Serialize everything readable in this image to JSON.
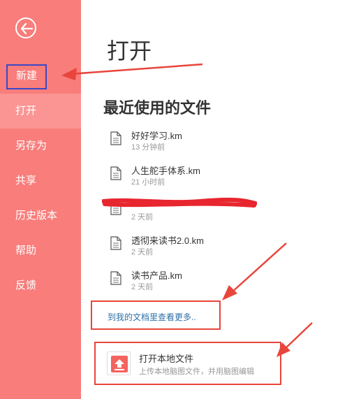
{
  "sidebar": {
    "items": [
      {
        "id": "new",
        "label": "新建"
      },
      {
        "id": "open",
        "label": "打开"
      },
      {
        "id": "save-as",
        "label": "另存为"
      },
      {
        "id": "share",
        "label": "共享"
      },
      {
        "id": "history",
        "label": "历史版本"
      },
      {
        "id": "help",
        "label": "帮助"
      },
      {
        "id": "feedback",
        "label": "反馈"
      }
    ],
    "active": "open"
  },
  "main": {
    "title": "打开",
    "recent_title": "最近使用的文件",
    "recent_files": [
      {
        "name": "好好学习.km",
        "time": "13 分钟前"
      },
      {
        "name": "人生舵手体系.km",
        "time": "21 小时前"
      },
      {
        "name": "",
        "time": "2 天前"
      },
      {
        "name": "透彻来读书2.0.km",
        "time": "2 天前"
      },
      {
        "name": "读书产品.km",
        "time": "2 天前"
      }
    ],
    "more_link": "到我的文档里查看更多..",
    "upload": {
      "title": "打开本地文件",
      "subtitle": "上传本地脑图文件，并用脑图编辑"
    }
  },
  "colors": {
    "sidebar_bg": "#f87d7b",
    "active_item_bg": "#fb9593",
    "annotation_red": "#e8453c",
    "highlight_blue": "#3b48c8",
    "link": "#2e6fa8"
  }
}
